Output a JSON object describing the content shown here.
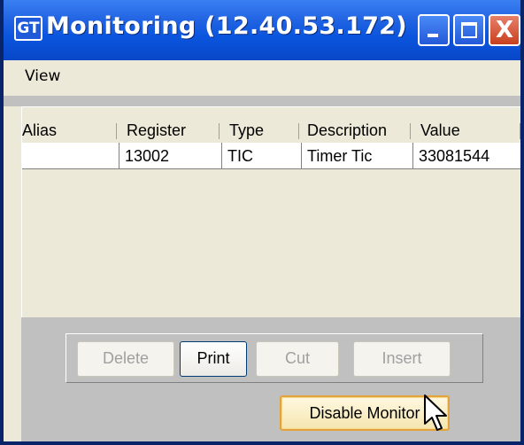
{
  "window": {
    "title": "Monitoring  (12.40.53.172)",
    "icon_text": "GT"
  },
  "titlebar": {
    "minimize_icon": "minimize-icon",
    "maximize_icon": "maximize-icon",
    "close_icon": "close-icon",
    "close_glyph": "X"
  },
  "menu": {
    "items": [
      {
        "label": "View"
      }
    ]
  },
  "table": {
    "columns": [
      "Alias",
      "Register",
      "Type",
      "Description",
      "Value"
    ],
    "rows": [
      {
        "alias": "",
        "register": "13002",
        "type": "TIC",
        "description": "Timer Tic",
        "value": "33081544"
      }
    ]
  },
  "buttons": {
    "delete": "Delete",
    "print": "Print",
    "cut": "Cut",
    "insert": "Insert",
    "disable_monitor": "Disable Monitor"
  },
  "colors": {
    "titlebar": "#0B55DE",
    "window_bg": "#ECE9D8",
    "panel_bg": "#C0C0C0",
    "disabled_text": "#A0A0A0"
  }
}
